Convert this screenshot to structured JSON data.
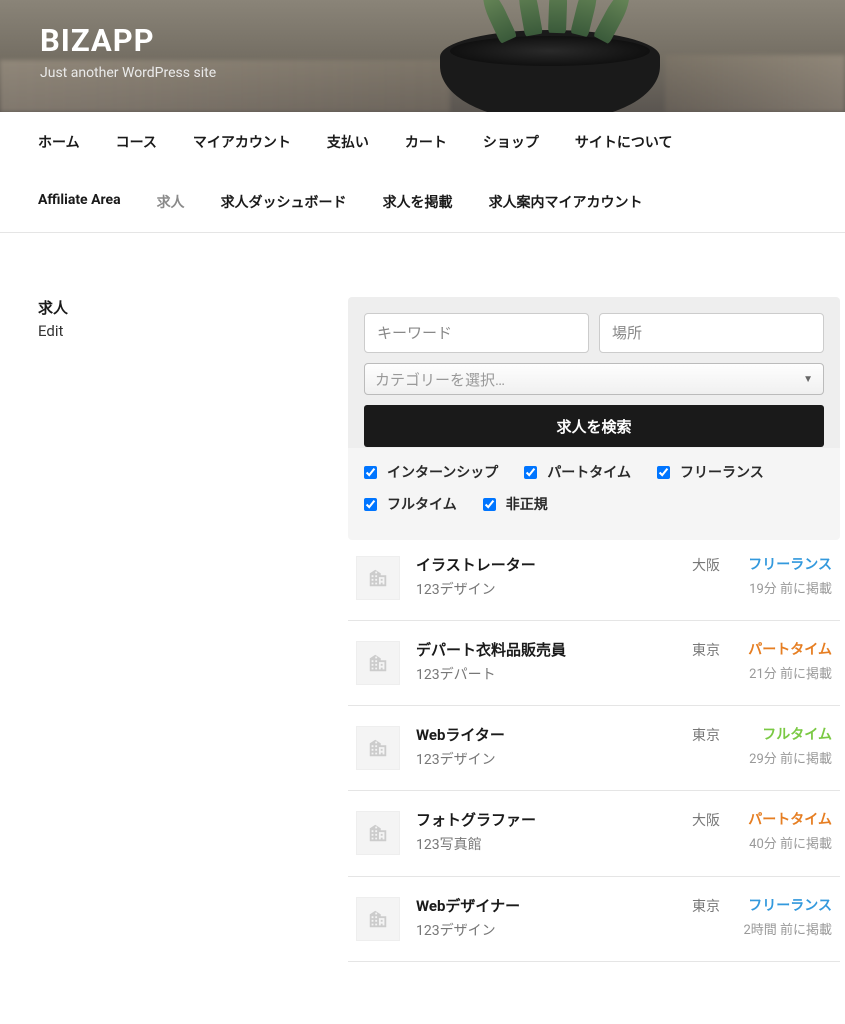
{
  "site": {
    "title": "BIZAPP",
    "tagline": "Just another WordPress site"
  },
  "nav": [
    {
      "label": "ホーム",
      "active": false
    },
    {
      "label": "コース",
      "active": false
    },
    {
      "label": "マイアカウント",
      "active": false
    },
    {
      "label": "支払い",
      "active": false
    },
    {
      "label": "カート",
      "active": false
    },
    {
      "label": "ショップ",
      "active": false
    },
    {
      "label": "サイトについて",
      "active": false
    },
    {
      "label": "Affiliate Area",
      "active": false
    },
    {
      "label": "求人",
      "active": true
    },
    {
      "label": "求人ダッシュボード",
      "active": false
    },
    {
      "label": "求人を掲載",
      "active": false
    },
    {
      "label": "求人案内マイアカウント",
      "active": false
    }
  ],
  "sidebar": {
    "title": "求人",
    "edit": "Edit"
  },
  "search": {
    "keyword_placeholder": "キーワード",
    "location_placeholder": "場所",
    "category_placeholder": "カテゴリーを選択…",
    "button": "求人を検索"
  },
  "filters": [
    {
      "label": "インターンシップ",
      "checked": true
    },
    {
      "label": "パートタイム",
      "checked": true
    },
    {
      "label": "フリーランス",
      "checked": true
    },
    {
      "label": "フルタイム",
      "checked": true
    },
    {
      "label": "非正規",
      "checked": true
    }
  ],
  "jobs": [
    {
      "title": "イラストレーター",
      "company": "123デザイン",
      "location": "大阪",
      "type": "フリーランス",
      "type_class": "freelance",
      "time": "19分 前に掲載"
    },
    {
      "title": "デパート衣料品販売員",
      "company": "123デパート",
      "location": "東京",
      "type": "パートタイム",
      "type_class": "parttime",
      "time": "21分 前に掲載"
    },
    {
      "title": "Webライター",
      "company": "123デザイン",
      "location": "東京",
      "type": "フルタイム",
      "type_class": "fulltime",
      "time": "29分 前に掲載"
    },
    {
      "title": "フォトグラファー",
      "company": "123写真館",
      "location": "大阪",
      "type": "パートタイム",
      "type_class": "parttime",
      "time": "40分 前に掲載"
    },
    {
      "title": "Webデザイナー",
      "company": "123デザイン",
      "location": "東京",
      "type": "フリーランス",
      "type_class": "freelance",
      "time": "2時間 前に掲載"
    }
  ]
}
